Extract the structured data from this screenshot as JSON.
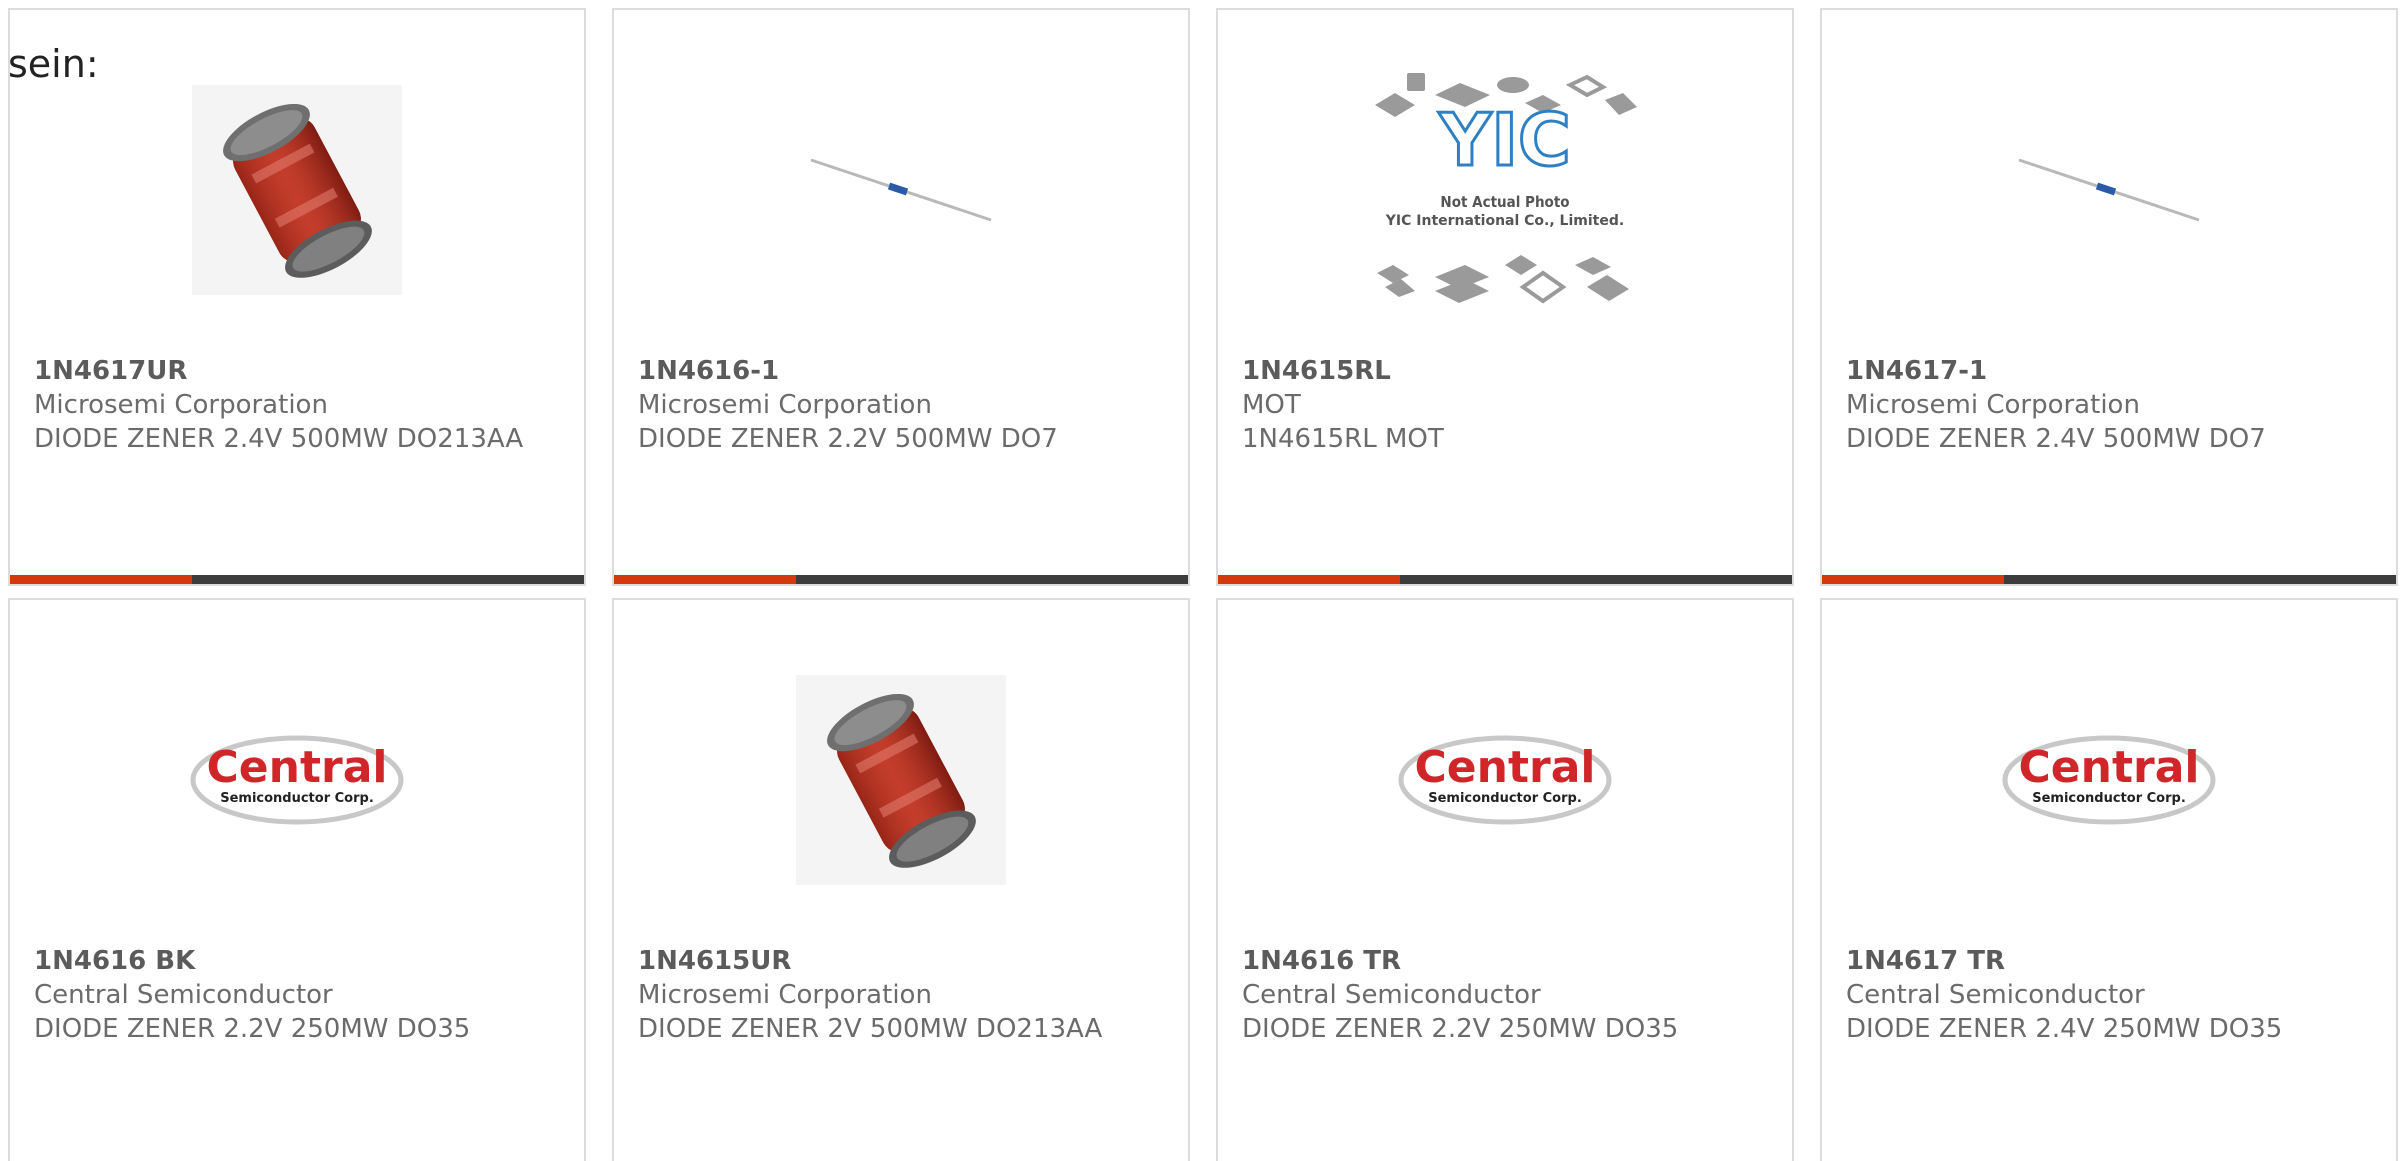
{
  "intro_text": "sein:",
  "colors": {
    "card_border": "#dcdcdc",
    "bar_dark": "#3c3c3c",
    "bar_accent": "#d4380d",
    "text_gray": "#6b6b6b"
  },
  "cards": [
    {
      "part_number": "1N4617UR",
      "manufacturer": "Microsemi Corporation",
      "description": "DIODE ZENER 2.4V 500MW DO213AA",
      "image": "red-melf-diode-icon"
    },
    {
      "part_number": "1N4616-1",
      "manufacturer": "Microsemi Corporation",
      "description": "DIODE ZENER 2.2V 500MW DO7",
      "image": "axial-diode-icon"
    },
    {
      "part_number": "1N4615RL",
      "manufacturer": "MOT",
      "description": "1N4615RL MOT",
      "image": "yic-placeholder-logo",
      "logo_text": "YIC",
      "logo_caption_1": "Not Actual Photo",
      "logo_caption_2": "YIC International Co., Limited."
    },
    {
      "part_number": "1N4617-1",
      "manufacturer": "Microsemi Corporation",
      "description": "DIODE ZENER 2.4V 500MW DO7",
      "image": "axial-diode-icon"
    },
    {
      "part_number": "1N4616 BK",
      "manufacturer": "Central Semiconductor",
      "description": "DIODE ZENER 2.2V 250MW DO35",
      "image": "central-semiconductor-logo",
      "logo_text": "Central",
      "logo_sub": "Semiconductor Corp."
    },
    {
      "part_number": "1N4615UR",
      "manufacturer": "Microsemi Corporation",
      "description": "DIODE ZENER 2V 500MW DO213AA",
      "image": "red-melf-diode-icon"
    },
    {
      "part_number": "1N4616 TR",
      "manufacturer": "Central Semiconductor",
      "description": "DIODE ZENER 2.2V 250MW DO35",
      "image": "central-semiconductor-logo",
      "logo_text": "Central",
      "logo_sub": "Semiconductor Corp."
    },
    {
      "part_number": "1N4617 TR",
      "manufacturer": "Central Semiconductor",
      "description": "DIODE ZENER 2.4V 250MW DO35",
      "image": "central-semiconductor-logo",
      "logo_text": "Central",
      "logo_sub": "Semiconductor Corp."
    }
  ]
}
